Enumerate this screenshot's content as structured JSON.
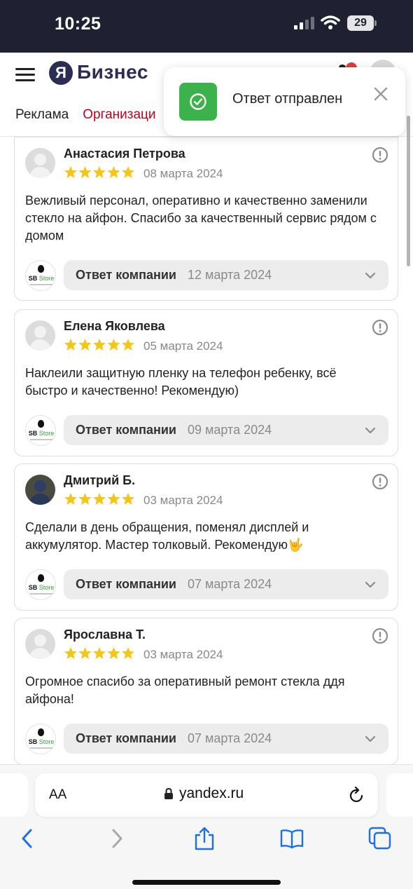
{
  "status_bar": {
    "time": "10:25",
    "battery": "29"
  },
  "header": {
    "logo_letter": "Я",
    "logo_text": "Бизнес",
    "tabs": [
      {
        "label": "Реклама"
      },
      {
        "label": "Организаци"
      }
    ]
  },
  "toast": {
    "message": "Ответ отправлен"
  },
  "reviews": [
    {
      "author": "Анастасия Петрова",
      "rating": 5,
      "date": "08 марта 2024",
      "text": "Вежливый персонал, оперативно и качественно заменили стекло на айфон. Спасибо за качественный сервис рядом с домом",
      "reply_label": "Ответ компании",
      "reply_date": "12 марта 2024"
    },
    {
      "author": "Елена Яковлева",
      "rating": 5,
      "date": "05 марта 2024",
      "text": "Наклеили защитную пленку на телефон ребенку, всё быстро и качественно! Рекомендую)",
      "reply_label": "Ответ компании",
      "reply_date": "09 марта 2024"
    },
    {
      "author": "Дмитрий Б.",
      "rating": 5,
      "date": "03 марта 2024",
      "text": "Сделали в день обращения, поменял дисплей и аккумулятор. Мастер толковый. Рекомендую🤟",
      "reply_label": "Ответ компании",
      "reply_date": "07 марта 2024"
    },
    {
      "author": "Ярославна Т.",
      "rating": 5,
      "date": "03 марта 2024",
      "text": "Огромное спасибо за оперативный ремонт стекла ддя айфона!",
      "reply_label": "Ответ компании",
      "reply_date": "07 марта 2024"
    }
  ],
  "company_logo": {
    "line1": "SB",
    "line2": "Store"
  },
  "browser": {
    "text_size": "AA",
    "url": "yandex.ru"
  },
  "icons": {
    "menu": "hamburger-icon",
    "report": "exclamation-circle-icon",
    "success": "check-circle-icon",
    "close": "close-icon",
    "reply_toggle": "chevron-down-icon",
    "back": "chevron-left-icon",
    "forward": "chevron-right-icon",
    "share": "share-icon",
    "bookmarks": "book-icon",
    "tabs": "tabs-icon"
  },
  "colors": {
    "status_bar": "#1f2132",
    "brand": "#2b2d55",
    "active_tab": "#c4001a",
    "success": "#3cb34a",
    "star": "#f5c518"
  }
}
